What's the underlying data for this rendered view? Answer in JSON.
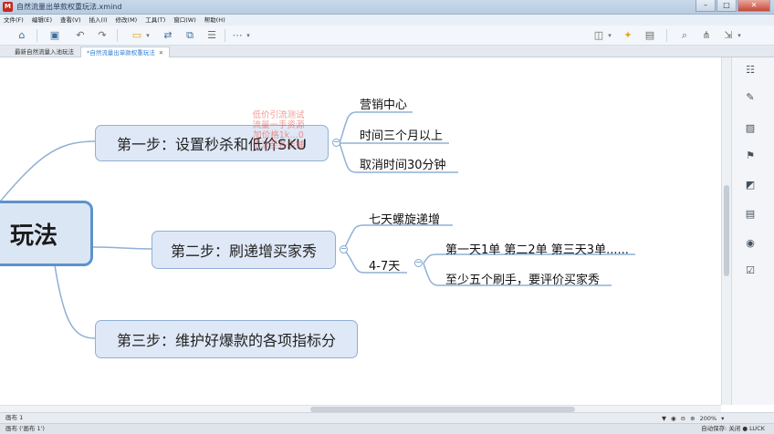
{
  "window": {
    "title": "自然流量出单款权重玩法.xmind",
    "app_badge": "M",
    "controls": [
      "–",
      "□",
      "✕"
    ]
  },
  "menu": [
    "文件(F)",
    "编辑(E)",
    "查看(V)",
    "插入(I)",
    "修改(M)",
    "工具(T)",
    "窗口(W)",
    "帮助(H)"
  ],
  "tabs": [
    {
      "label": "最新自然流量入池玩法",
      "active": false
    },
    {
      "label": "*自然流量出单款权重玩法",
      "active": true,
      "close": "✕"
    }
  ],
  "mindmap": {
    "root": "玩法",
    "branches": [
      {
        "label": "第一步：设置秒杀和低价SKU",
        "children": [
          "营销中心",
          "时间三个月以上",
          "取消时间30分钟"
        ]
      },
      {
        "label": "第二步：刷递增买家秀",
        "children": [
          "七天螺旋递增",
          "4-7天"
        ],
        "sub_children": [
          "第一天1单 第二2单 第三天3单......",
          "至少五个刷手，要评价买家秀"
        ]
      },
      {
        "label": "第三步：维护好爆款的各项指标分",
        "children": []
      }
    ],
    "annotation_lines": [
      "低价引流测试",
      "流量一手资源",
      "加价格1k…0",
      "引流至各店铺"
    ]
  },
  "status": {
    "sheet": "画布 1",
    "zoom": "200%",
    "bottom_left": "画布 ('画布 1')",
    "bottom_right": "自动保存: 关闭   ● LUCK"
  },
  "colors": {
    "accent": "#5c93cc",
    "node_fill": "#dfe8f6",
    "annotation": "#eb463c"
  }
}
